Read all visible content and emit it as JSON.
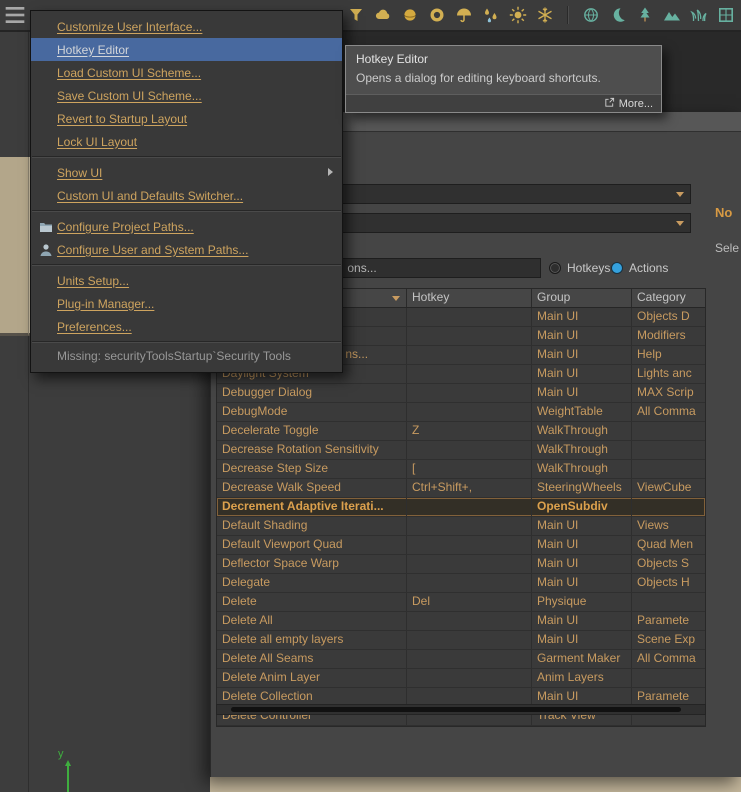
{
  "colors": {
    "accent_orange": "#c89b60",
    "menu_highlight_blue": "#48699f",
    "radio_selected_blue": "#35a1dd",
    "viewport_beige": "#c8bba0",
    "dialog_gray": "#454545"
  },
  "toolbar": {
    "icons": [
      {
        "name": "funnel-icon",
        "color": "#d2af52"
      },
      {
        "name": "cloud-icon",
        "color": "#d2af52"
      },
      {
        "name": "sphere-icon",
        "color": "#d4a93f"
      },
      {
        "name": "torus-icon",
        "color": "#d2af52"
      },
      {
        "name": "umbrella-icon",
        "color": "#d2af52"
      },
      {
        "name": "raindrops-icon",
        "color": "#d2af52"
      },
      {
        "name": "sun-icon",
        "color": "#d2af52"
      },
      {
        "name": "snowflake-icon",
        "color": "#d2af52"
      },
      {
        "name": "globe-icon",
        "color": "#67b1a0"
      },
      {
        "name": "moon-icon",
        "color": "#67b1a0"
      },
      {
        "name": "tree-icon",
        "color": "#67b1a0"
      },
      {
        "name": "mountain-icon",
        "color": "#67b1a0"
      },
      {
        "name": "grass-icon",
        "color": "#67b1a0"
      },
      {
        "name": "window-icon",
        "color": "#67b1a0"
      }
    ]
  },
  "menu": {
    "items": [
      {
        "type": "item",
        "label": "Customize User Interface..."
      },
      {
        "type": "item",
        "label": "Hotkey Editor",
        "highlighted": true
      },
      {
        "type": "item",
        "label": "Load Custom UI Scheme..."
      },
      {
        "type": "item",
        "label": "Save Custom UI Scheme..."
      },
      {
        "type": "item",
        "label": "Revert to Startup Layout"
      },
      {
        "type": "item",
        "label": "Lock UI Layout"
      },
      {
        "type": "separator"
      },
      {
        "type": "item",
        "label": "Show UI",
        "submenu": true
      },
      {
        "type": "item",
        "label": "Custom UI and Defaults Switcher..."
      },
      {
        "type": "separator"
      },
      {
        "type": "item",
        "label": "Configure Project Paths...",
        "icon": "folder-icon"
      },
      {
        "type": "item",
        "label": "Configure User and System Paths...",
        "icon": "user-icon"
      },
      {
        "type": "separator"
      },
      {
        "type": "item",
        "label": "Units Setup..."
      },
      {
        "type": "item",
        "label": "Plug-in Manager..."
      },
      {
        "type": "item",
        "label": "Preferences..."
      },
      {
        "type": "separator"
      },
      {
        "type": "status",
        "label": "Missing: securityToolsStartup`Security Tools"
      }
    ]
  },
  "tooltip": {
    "title": "Hotkey Editor",
    "body": "Opens a dialog for editing keyboard shortcuts.",
    "more_label": "More..."
  },
  "dialog": {
    "combo1_value": "",
    "combo2_value": "",
    "search_value": "                                  ons...",
    "radio_hotkeys_label": "Hotkeys",
    "radio_actions_label": "Actions",
    "selected_radio": "Actions",
    "side_note_primary": "No",
    "side_note_secondary": "Sele",
    "table": {
      "columns": [
        "",
        "Hotkey",
        "Group",
        "Category"
      ],
      "rows": [
        {
          "action": "",
          "hotkey": "",
          "group": "Main UI",
          "category": "Objects D"
        },
        {
          "action": "",
          "hotkey": "",
          "group": "Main UI",
          "category": "Modifiers"
        },
        {
          "action": "                                     ns...",
          "hotkey": "",
          "group": "Main UI",
          "category": "Help"
        },
        {
          "action": "Daylight System",
          "hotkey": "",
          "group": "Main UI",
          "category": "Lights anc"
        },
        {
          "action": "Debugger Dialog",
          "hotkey": "",
          "group": "Main UI",
          "category": "MAX Scrip"
        },
        {
          "action": "DebugMode",
          "hotkey": "",
          "group": "WeightTable",
          "category": "All Comma"
        },
        {
          "action": "Decelerate Toggle",
          "hotkey": "Z",
          "group": "WalkThrough",
          "category": ""
        },
        {
          "action": "Decrease Rotation Sensitivity",
          "hotkey": "",
          "group": "WalkThrough",
          "category": ""
        },
        {
          "action": "Decrease Step Size",
          "hotkey": "[",
          "group": "WalkThrough",
          "category": ""
        },
        {
          "action": "Decrease Walk Speed",
          "hotkey": "Ctrl+Shift+,",
          "group": "SteeringWheels",
          "category": "ViewCube"
        },
        {
          "action": "Decrement Adaptive Iterati...",
          "hotkey": "",
          "group": "OpenSubdiv",
          "category": "",
          "selected": true
        },
        {
          "action": "Default Shading",
          "hotkey": "",
          "group": "Main UI",
          "category": "Views"
        },
        {
          "action": "Default Viewport Quad",
          "hotkey": "",
          "group": "Main UI",
          "category": "Quad Men"
        },
        {
          "action": "Deflector Space Warp",
          "hotkey": "",
          "group": "Main UI",
          "category": "Objects S"
        },
        {
          "action": "Delegate",
          "hotkey": "",
          "group": "Main UI",
          "category": "Objects H"
        },
        {
          "action": "Delete",
          "hotkey": "Del",
          "group": "Physique",
          "category": ""
        },
        {
          "action": "Delete All",
          "hotkey": "",
          "group": "Main UI",
          "category": "Paramete"
        },
        {
          "action": "Delete all empty layers",
          "hotkey": "",
          "group": "Main UI",
          "category": "Scene Exp"
        },
        {
          "action": "Delete All Seams",
          "hotkey": "",
          "group": "Garment Maker",
          "category": "All Comma"
        },
        {
          "action": "Delete Anim Layer",
          "hotkey": "",
          "group": "Anim Layers",
          "category": ""
        },
        {
          "action": "Delete Collection",
          "hotkey": "",
          "group": "Main UI",
          "category": "Paramete"
        },
        {
          "action": "Delete Controller",
          "hotkey": "",
          "group": "Track View",
          "category": ""
        }
      ]
    }
  },
  "viewport": {
    "axis_label": "y"
  }
}
